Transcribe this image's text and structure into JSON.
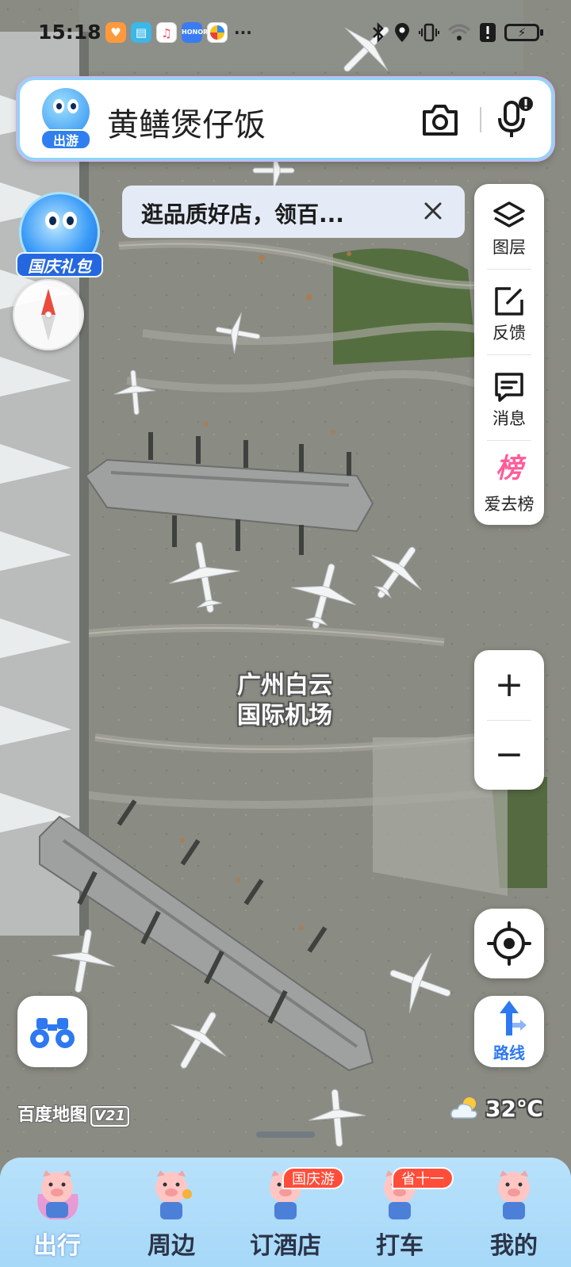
{
  "status_bar": {
    "time": "15:18",
    "app_icons": [
      "heart-app-icon",
      "book-app-icon",
      "music-app-icon",
      "honor-app-icon",
      "browser-app-icon"
    ],
    "more": "···",
    "battery": "⚡"
  },
  "search": {
    "logo_tag": "出游",
    "query": "黄鳝煲仔饭"
  },
  "promo": {
    "text": "逛品质好店，领百..."
  },
  "gift_badge": {
    "label": "国庆礼包"
  },
  "tools": [
    {
      "name": "layers",
      "label": "图层"
    },
    {
      "name": "feedback",
      "label": "反馈"
    },
    {
      "name": "messages",
      "label": "消息"
    },
    {
      "name": "ranking",
      "label": "爱去榜",
      "glyph": "榜"
    }
  ],
  "zoom": {
    "in": "+",
    "out": "−"
  },
  "route": {
    "label": "路线"
  },
  "map": {
    "poi_label_line1": "广州白云",
    "poi_label_line2": "国际机场",
    "brand": "百度地图",
    "brand_version": "V21"
  },
  "weather": {
    "temp": "32℃"
  },
  "bottom_nav": [
    {
      "label": "出行",
      "active": true
    },
    {
      "label": "周边",
      "active": false
    },
    {
      "label": "订酒店",
      "active": false,
      "badge": "国庆游"
    },
    {
      "label": "打车",
      "active": false,
      "badge": "省十一"
    },
    {
      "label": "我的",
      "active": false
    }
  ],
  "colors": {
    "accent": "#2e78f0",
    "nav_bg": "#a6d8f8",
    "badge": "#ff4d3a",
    "rank": "#ff5c9a"
  }
}
